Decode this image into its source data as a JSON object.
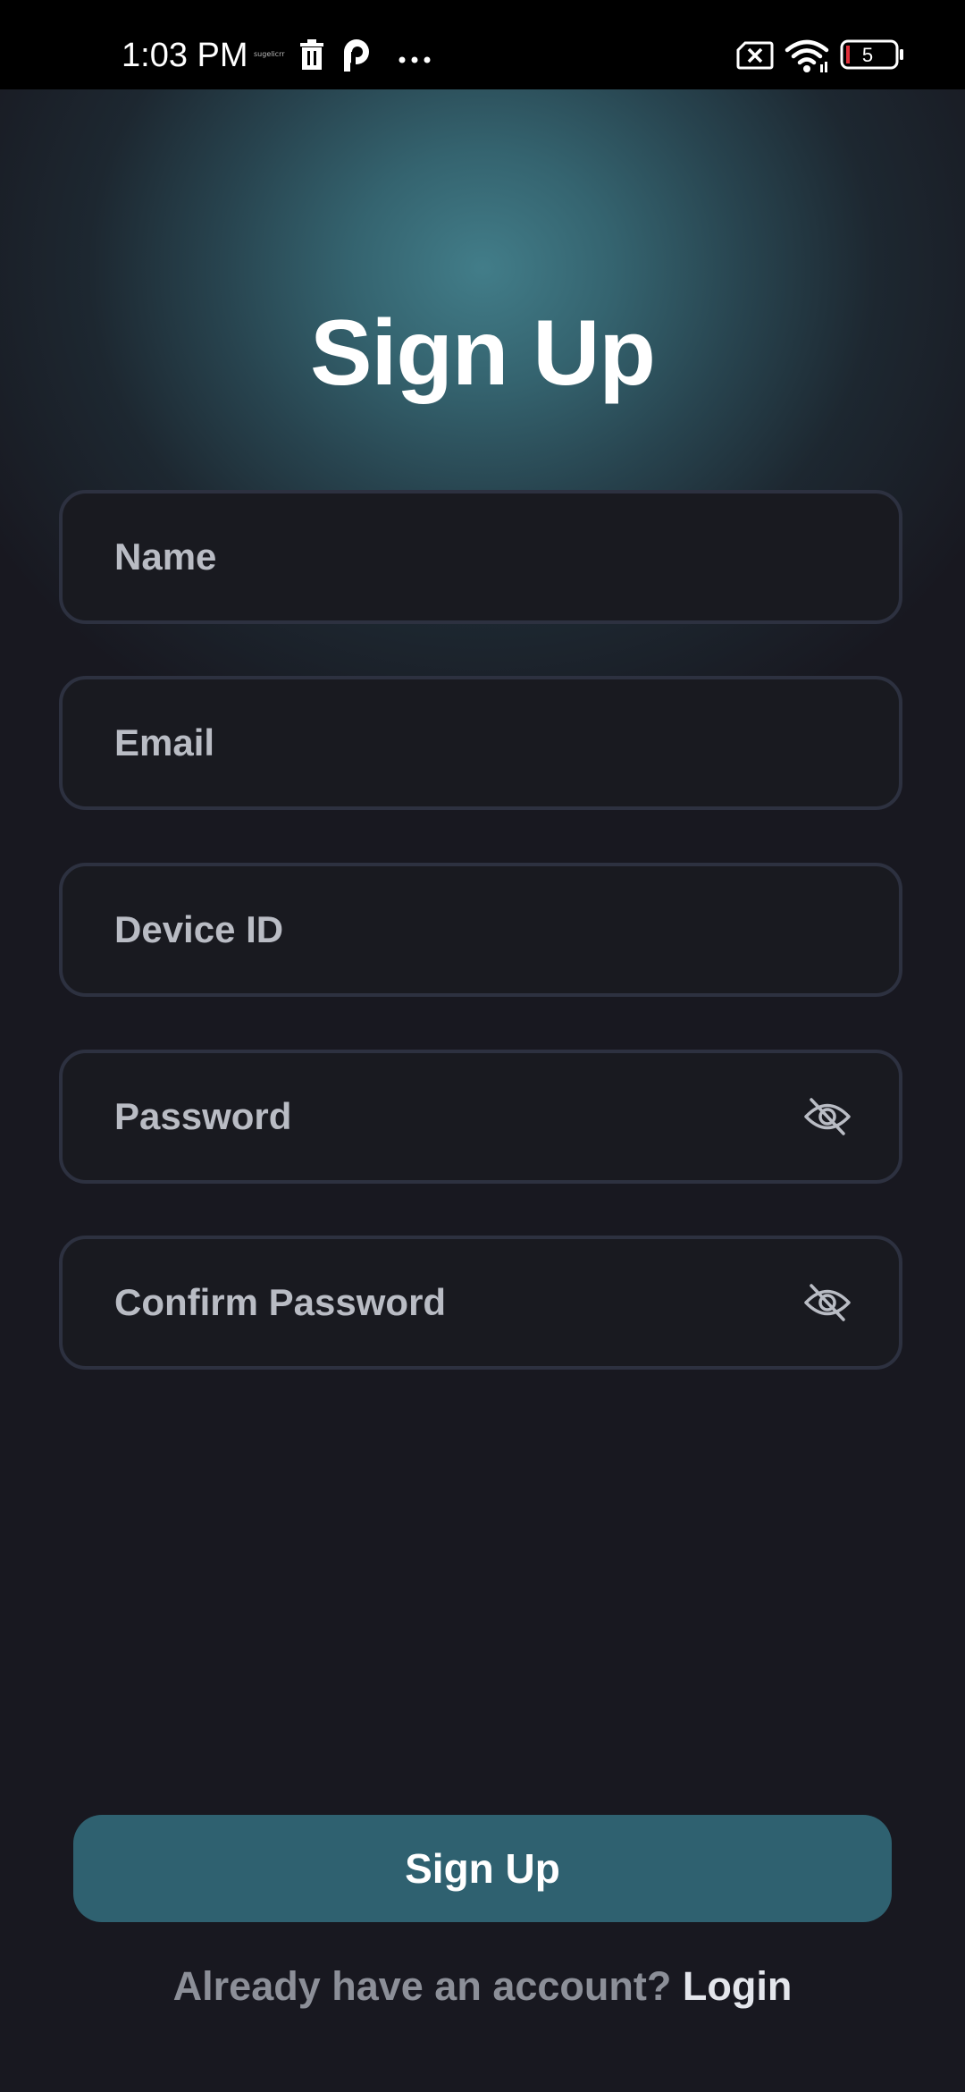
{
  "status_bar": {
    "time": "1:03 PM",
    "mini_text": "sugelicrr",
    "battery_level": "5",
    "icons": [
      "trash-icon",
      "p-app-icon",
      "more-dots-icon",
      "sim-blocked-icon",
      "wifi-icon",
      "battery-icon"
    ]
  },
  "header": {
    "title": "Sign Up"
  },
  "form": {
    "name_placeholder": "Name",
    "email_placeholder": "Email",
    "device_id_placeholder": "Device ID",
    "password_placeholder": "Password",
    "confirm_password_placeholder": "Confirm Password",
    "password_toggle_icon": "eye-off-icon",
    "confirm_password_toggle_icon": "eye-off-icon"
  },
  "actions": {
    "signup_label": "Sign Up"
  },
  "footer": {
    "prompt": "Already have an account?",
    "login_label": "Login"
  },
  "colors": {
    "background": "#181820",
    "accent": "#2f6170",
    "glow": "#427d89",
    "field_border": "#2d3140",
    "field_fill": "#191a20",
    "placeholder": "#b9bcc4"
  }
}
